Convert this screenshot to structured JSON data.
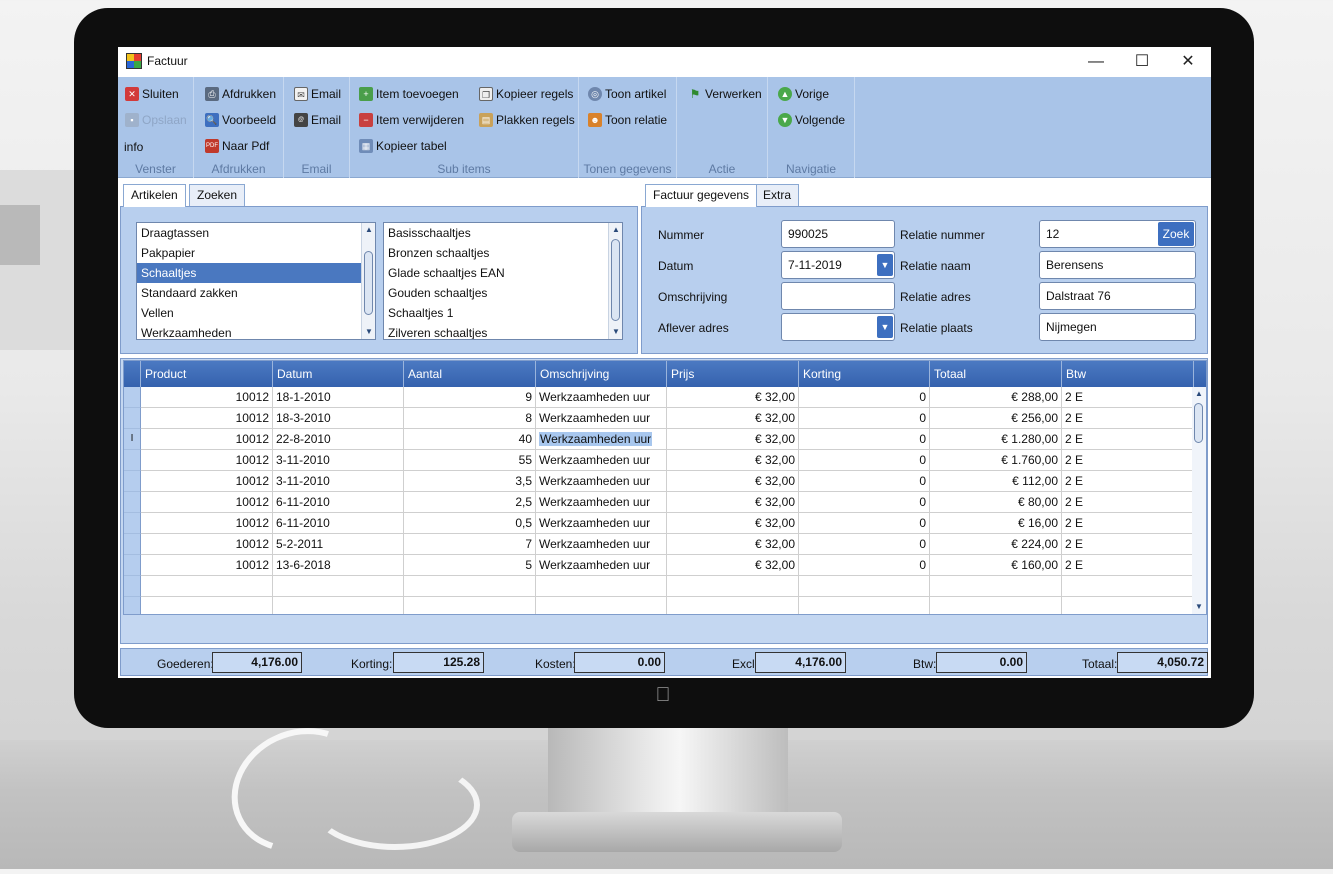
{
  "window": {
    "title": "Factuur"
  },
  "ribbon": {
    "venster": {
      "label": "Venster",
      "sluiten": "Sluiten",
      "opslaan": "Opslaan",
      "info": "info"
    },
    "afdrukken": {
      "label": "Afdrukken",
      "afdrukken": "Afdrukken",
      "voorbeeld": "Voorbeeld",
      "naar_pdf": "Naar Pdf"
    },
    "email": {
      "label": "Email",
      "email1": "Email",
      "email2": "Email"
    },
    "sub_items": {
      "label": "Sub items",
      "item_toevoegen": "Item toevoegen",
      "item_verwijderen": "Item verwijderen",
      "kopieer_tabel": "Kopieer tabel",
      "kopieer_regels": "Kopieer regels",
      "plakken_regels": "Plakken regels"
    },
    "tonen": {
      "label": "Tonen gegevens",
      "toon_artikel": "Toon artikel",
      "toon_relatie": "Toon relatie"
    },
    "actie": {
      "label": "Actie",
      "verwerken": "Verwerken"
    },
    "navigatie": {
      "label": "Navigatie",
      "vorige": "Vorige",
      "volgende": "Volgende"
    }
  },
  "left_tabs": [
    "Artikelen",
    "Zoeken"
  ],
  "categories": [
    "Draagtassen",
    "Pakpapier",
    "Schaaltjes",
    "Standaard zakken",
    "Vellen",
    "Werkzaamheden"
  ],
  "selected_category_index": 2,
  "products": [
    "Basisschaaltjes",
    "Bronzen schaaltjes",
    "Glade schaaltjes EAN",
    "Gouden schaaltjes",
    "Schaaltjes 1",
    "Zilveren schaaltjes"
  ],
  "right_tabs": [
    "Factuur gegevens",
    "Extra"
  ],
  "form": {
    "nummer_label": "Nummer",
    "nummer": "990025",
    "datum_label": "Datum",
    "datum": "7-11-2019",
    "omschrijving_label": "Omschrijving",
    "omschrijving": "",
    "aflever_label": "Aflever adres",
    "aflever": "",
    "relatie_nummer_label": "Relatie nummer",
    "relatie_nummer": "12",
    "zoek": "Zoek",
    "relatie_naam_label": "Relatie naam",
    "relatie_naam": "Berensens",
    "relatie_adres_label": "Relatie adres",
    "relatie_adres": "Dalstraat 76",
    "relatie_plaats_label": "Relatie plaats",
    "relatie_plaats": "Nijmegen"
  },
  "grid": {
    "columns": [
      "Product",
      "Datum",
      "Aantal",
      "Omschrijving",
      "Prijs",
      "Korting",
      "Totaal",
      "Btw"
    ],
    "rows": [
      [
        "10012",
        "18-1-2010",
        "9",
        "Werkzaamheden uur",
        "€ 32,00",
        "0",
        "€ 288,00",
        "2 E"
      ],
      [
        "10012",
        "18-3-2010",
        "8",
        "Werkzaamheden uur",
        "€ 32,00",
        "0",
        "€ 256,00",
        "2 E"
      ],
      [
        "10012",
        "22-8-2010",
        "40",
        "Werkzaamheden uur",
        "€ 32,00",
        "0",
        "€ 1.280,00",
        "2 E"
      ],
      [
        "10012",
        "3-11-2010",
        "55",
        "Werkzaamheden uur",
        "€ 32,00",
        "0",
        "€ 1.760,00",
        "2 E"
      ],
      [
        "10012",
        "3-11-2010",
        "3,5",
        "Werkzaamheden uur",
        "€ 32,00",
        "0",
        "€ 112,00",
        "2 E"
      ],
      [
        "10012",
        "6-11-2010",
        "2,5",
        "Werkzaamheden uur",
        "€ 32,00",
        "0",
        "€ 80,00",
        "2 E"
      ],
      [
        "10012",
        "6-11-2010",
        "0,5",
        "Werkzaamheden uur",
        "€ 32,00",
        "0",
        "€ 16,00",
        "2 E"
      ],
      [
        "10012",
        "5-2-2011",
        "7",
        "Werkzaamheden uur",
        "€ 32,00",
        "0",
        "€ 224,00",
        "2 E"
      ],
      [
        "10012",
        "13-6-2018",
        "5",
        "Werkzaamheden uur",
        "€ 32,00",
        "0",
        "€ 160,00",
        "2 E"
      ]
    ],
    "editing_row_index": 2
  },
  "totals": {
    "goederen_label": "Goederen:",
    "goederen": "4,176.00",
    "korting_label": "Korting:",
    "korting": "125.28",
    "kosten_label": "Kosten:",
    "kosten": "0.00",
    "excl_label": "Excl:",
    "excl": "4,176.00",
    "btw_label": "Btw:",
    "btw": "0.00",
    "totaal_label": "Totaal:",
    "totaal": "4,050.72"
  },
  "colors": {
    "ribbon": "#a9c4e8",
    "panel": "#b8cfee",
    "grid_header": "#3d6bb7",
    "selection": "#4a78c0",
    "button": "#3d6fc0"
  }
}
